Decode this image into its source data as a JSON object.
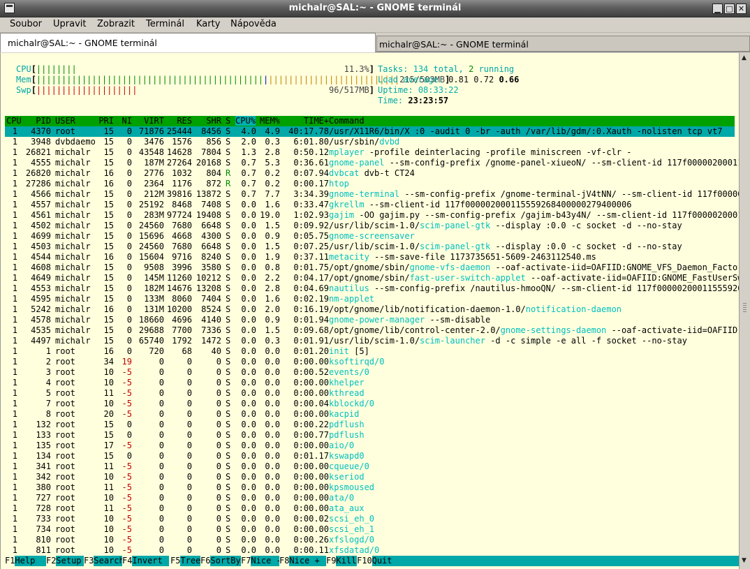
{
  "window": {
    "title": "michalr@SAL:~ - GNOME terminál",
    "menu": [
      "Soubor",
      "Upravit",
      "Zobrazit",
      "Terminál",
      "Karty",
      "Nápověda"
    ],
    "tabs": [
      {
        "label": "michalr@SAL:~ - GNOME terminál",
        "active": true
      },
      {
        "label": "michalr@SAL:~ - GNOME terminál",
        "active": false
      }
    ]
  },
  "meters": {
    "cpu": {
      "label": "CPU",
      "bars": "||||||||",
      "value": "11.3%"
    },
    "mem": {
      "label": "Mem",
      "bars_used": "|||||||||||||||||||||||||||||||||||||||||||||",
      "bars_buffer": "|",
      "bars_cache": "||||||||||||||||||||||||||",
      "value": "215/503MB"
    },
    "swp": {
      "label": "Swp",
      "bars": "||||||||||||||||||||",
      "value": "96/517MB"
    }
  },
  "info": {
    "tasks_label": "Tasks:",
    "tasks_total": "134",
    "total_label": "total,",
    "tasks_running": "2",
    "running_label": "running",
    "load_label": "Load average:",
    "load1": "0.81",
    "load5": "0.72",
    "load15": "0.66",
    "uptime_label": "Uptime:",
    "uptime": "08:33:22",
    "time_label": "Time:",
    "time": "23:23:57"
  },
  "columns": [
    "CPU",
    "PID",
    "USER",
    "PRI",
    "NI",
    "VIRT",
    "RES",
    "SHR",
    "S",
    "CPU%",
    "MEM%",
    "TIME+",
    "Command"
  ],
  "processes": [
    {
      "cpu": "1",
      "pid": "4370",
      "user": "root",
      "pri": "15",
      "ni": "0",
      "virt": "71876",
      "res": "25444",
      "shr": "8456",
      "s": "S",
      "cpup": "4.0",
      "memp": "4.9",
      "time": "40:17.78",
      "cmd_pre": "/usr/X11R6/bin/X :0 -audit 0 -br -auth /var/lib/gdm/:0.Xauth -nolisten tcp vt7",
      "cmd_hl": "",
      "cmd_post": ""
    },
    {
      "cpu": "1",
      "pid": "3948",
      "user": "dvbdaemo",
      "pri": "15",
      "ni": "0",
      "virt": "3476",
      "res": "1576",
      "shr": "856",
      "s": "S",
      "cpup": "2.0",
      "memp": "0.3",
      "time": "6:01.80",
      "cmd_pre": "/usr/sbin/",
      "cmd_hl": "dvbd",
      "cmd_post": ""
    },
    {
      "cpu": "1",
      "pid": "26821",
      "user": "michalr",
      "pri": "15",
      "ni": "0",
      "virt": "43548",
      "res": "14628",
      "shr": "7804",
      "s": "S",
      "cpup": "1.3",
      "memp": "2.8",
      "time": "0:50.12",
      "cmd_pre": "",
      "cmd_hl": "mplayer",
      "cmd_post": " -profile deinterlacing -profile miniscreen -vf-clr -"
    },
    {
      "cpu": "1",
      "pid": "4555",
      "user": "michalr",
      "pri": "15",
      "ni": "0",
      "virt": "187M",
      "res": "27264",
      "shr": "20168",
      "s": "S",
      "cpup": "0.7",
      "memp": "5.3",
      "time": "0:36.61",
      "cmd_pre": "",
      "cmd_hl": "gnome-panel",
      "cmd_post": " --sm-config-prefix /gnome-panel-xiueoN/ --sm-client-id 117f000002000115"
    },
    {
      "cpu": "1",
      "pid": "26820",
      "user": "michalr",
      "pri": "16",
      "ni": "0",
      "virt": "2776",
      "res": "1032",
      "shr": "804",
      "s": "R",
      "cpup": "0.7",
      "memp": "0.2",
      "time": "0:07.94",
      "cmd_pre": "",
      "cmd_hl": "dvbcat",
      "cmd_post": " dvb-t CT24"
    },
    {
      "cpu": "1",
      "pid": "27286",
      "user": "michalr",
      "pri": "16",
      "ni": "0",
      "virt": "2364",
      "res": "1176",
      "shr": "872",
      "s": "R",
      "cpup": "0.7",
      "memp": "0.2",
      "time": "0:00.17",
      "cmd_pre": "",
      "cmd_hl": "htop",
      "cmd_post": ""
    },
    {
      "cpu": "1",
      "pid": "4566",
      "user": "michalr",
      "pri": "15",
      "ni": "0",
      "virt": "212M",
      "res": "39816",
      "shr": "13872",
      "s": "S",
      "cpup": "0.7",
      "memp": "7.7",
      "time": "3:34.39",
      "cmd_pre": "",
      "cmd_hl": "gnome-terminal",
      "cmd_post": " --sm-config-prefix /gnome-terminal-jV4tNN/ --sm-client-id 117f000002"
    },
    {
      "cpu": "1",
      "pid": "4557",
      "user": "michalr",
      "pri": "15",
      "ni": "0",
      "virt": "25192",
      "res": "8468",
      "shr": "7408",
      "s": "S",
      "cpup": "0.0",
      "memp": "1.6",
      "time": "0:33.47",
      "cmd_pre": "",
      "cmd_hl": "gkrellm",
      "cmd_post": " --sm-client-id 117f000002000115559268400000279400006"
    },
    {
      "cpu": "1",
      "pid": "4561",
      "user": "michalr",
      "pri": "15",
      "ni": "0",
      "virt": "283M",
      "res": "97724",
      "shr": "19408",
      "s": "S",
      "cpup": "0.0",
      "memp": "19.0",
      "time": "1:02.93",
      "cmd_pre": "",
      "cmd_hl": "gajim",
      "cmd_post": " -OO gajim.py --sm-config-prefix /gajim-b43y4N/ --sm-client-id 117f00000200011"
    },
    {
      "cpu": "1",
      "pid": "4502",
      "user": "michalr",
      "pri": "15",
      "ni": "0",
      "virt": "24560",
      "res": "7680",
      "shr": "6648",
      "s": "S",
      "cpup": "0.0",
      "memp": "1.5",
      "time": "0:09.92",
      "cmd_pre": "/usr/lib/scim-1.0/",
      "cmd_hl": "scim-panel-gtk",
      "cmd_post": " --display :0.0 -c socket -d --no-stay"
    },
    {
      "cpu": "1",
      "pid": "4699",
      "user": "michalr",
      "pri": "15",
      "ni": "0",
      "virt": "15696",
      "res": "4668",
      "shr": "4300",
      "s": "S",
      "cpup": "0.0",
      "memp": "0.9",
      "time": "0:05.75",
      "cmd_pre": "",
      "cmd_hl": "gnome-screensaver",
      "cmd_post": ""
    },
    {
      "cpu": "1",
      "pid": "4503",
      "user": "michalr",
      "pri": "15",
      "ni": "0",
      "virt": "24560",
      "res": "7680",
      "shr": "6648",
      "s": "S",
      "cpup": "0.0",
      "memp": "1.5",
      "time": "0:07.25",
      "cmd_pre": "/usr/lib/scim-1.0/",
      "cmd_hl": "scim-panel-gtk",
      "cmd_post": " --display :0.0 -c socket -d --no-stay"
    },
    {
      "cpu": "1",
      "pid": "4544",
      "user": "michalr",
      "pri": "16",
      "ni": "0",
      "virt": "15604",
      "res": "9716",
      "shr": "8240",
      "s": "S",
      "cpup": "0.0",
      "memp": "1.9",
      "time": "0:37.11",
      "cmd_pre": "",
      "cmd_hl": "metacity",
      "cmd_post": " --sm-save-file 1173735651-5609-2463112540.ms"
    },
    {
      "cpu": "1",
      "pid": "4608",
      "user": "michalr",
      "pri": "15",
      "ni": "0",
      "virt": "9508",
      "res": "3996",
      "shr": "3580",
      "s": "S",
      "cpup": "0.0",
      "memp": "0.8",
      "time": "0:01.75",
      "cmd_pre": "/opt/gnome/sbin/",
      "cmd_hl": "gnome-vfs-daemon",
      "cmd_post": " --oaf-activate-iid=OAFIID:GNOME_VFS_Daemon_Factory"
    },
    {
      "cpu": "1",
      "pid": "4649",
      "user": "michalr",
      "pri": "15",
      "ni": "0",
      "virt": "145M",
      "res": "11260",
      "shr": "10212",
      "s": "S",
      "cpup": "0.0",
      "memp": "2.2",
      "time": "0:04.17",
      "cmd_pre": "/opt/gnome/sbin/",
      "cmd_hl": "fast-user-switch-applet",
      "cmd_post": " --oaf-activate-iid=OAFIID:GNOME_FastUserSwi"
    },
    {
      "cpu": "1",
      "pid": "4553",
      "user": "michalr",
      "pri": "15",
      "ni": "0",
      "virt": "182M",
      "res": "14676",
      "shr": "13208",
      "s": "S",
      "cpup": "0.0",
      "memp": "2.8",
      "time": "0:04.69",
      "cmd_pre": "",
      "cmd_hl": "nautilus",
      "cmd_post": " --sm-config-prefix /nautilus-hmooQN/ --sm-client-id 117f000002000115559267"
    },
    {
      "cpu": "1",
      "pid": "4595",
      "user": "michalr",
      "pri": "15",
      "ni": "0",
      "virt": "133M",
      "res": "8060",
      "shr": "7404",
      "s": "S",
      "cpup": "0.0",
      "memp": "1.6",
      "time": "0:02.19",
      "cmd_pre": "",
      "cmd_hl": "nm-applet",
      "cmd_post": ""
    },
    {
      "cpu": "1",
      "pid": "5242",
      "user": "michalr",
      "pri": "16",
      "ni": "0",
      "virt": "131M",
      "res": "10200",
      "shr": "8524",
      "s": "S",
      "cpup": "0.0",
      "memp": "2.0",
      "time": "0:16.19",
      "cmd_pre": "/opt/gnome/lib/notification-daemon-1.0/",
      "cmd_hl": "notification-daemon",
      "cmd_post": ""
    },
    {
      "cpu": "1",
      "pid": "4578",
      "user": "michalr",
      "pri": "15",
      "ni": "0",
      "virt": "18660",
      "res": "4696",
      "shr": "4140",
      "s": "S",
      "cpup": "0.0",
      "memp": "0.9",
      "time": "0:01.94",
      "cmd_pre": "",
      "cmd_hl": "gnome-power-manager",
      "cmd_post": " --sm-disable"
    },
    {
      "cpu": "1",
      "pid": "4535",
      "user": "michalr",
      "pri": "15",
      "ni": "0",
      "virt": "29688",
      "res": "7700",
      "shr": "7336",
      "s": "S",
      "cpup": "0.0",
      "memp": "1.5",
      "time": "0:09.68",
      "cmd_pre": "/opt/gnome/lib/control-center-2.0/",
      "cmd_hl": "gnome-settings-daemon",
      "cmd_post": " --oaf-activate-iid=OAFIID:G"
    },
    {
      "cpu": "1",
      "pid": "4497",
      "user": "michalr",
      "pri": "15",
      "ni": "0",
      "virt": "65740",
      "res": "1792",
      "shr": "1472",
      "s": "S",
      "cpup": "0.0",
      "memp": "0.3",
      "time": "0:01.91",
      "cmd_pre": "/usr/lib/scim-1.0/",
      "cmd_hl": "scim-launcher",
      "cmd_post": " -d -c simple -e all -f socket --no-stay"
    },
    {
      "cpu": "1",
      "pid": "1",
      "user": "root",
      "pri": "16",
      "ni": "0",
      "virt": "720",
      "res": "68",
      "shr": "40",
      "s": "S",
      "cpup": "0.0",
      "memp": "0.0",
      "time": "0:01.20",
      "cmd_pre": "",
      "cmd_hl": "init",
      "cmd_post": " [5]"
    },
    {
      "cpu": "1",
      "pid": "2",
      "user": "root",
      "pri": "34",
      "ni": "19",
      "virt": "0",
      "res": "0",
      "shr": "0",
      "s": "S",
      "cpup": "0.0",
      "memp": "0.0",
      "time": "0:00.00",
      "cmd_pre": "",
      "cmd_hl": "ksoftirqd/0",
      "cmd_post": ""
    },
    {
      "cpu": "1",
      "pid": "3",
      "user": "root",
      "pri": "10",
      "ni": "-5",
      "virt": "0",
      "res": "0",
      "shr": "0",
      "s": "S",
      "cpup": "0.0",
      "memp": "0.0",
      "time": "0:00.52",
      "cmd_pre": "",
      "cmd_hl": "events/0",
      "cmd_post": ""
    },
    {
      "cpu": "1",
      "pid": "4",
      "user": "root",
      "pri": "10",
      "ni": "-5",
      "virt": "0",
      "res": "0",
      "shr": "0",
      "s": "S",
      "cpup": "0.0",
      "memp": "0.0",
      "time": "0:00.00",
      "cmd_pre": "",
      "cmd_hl": "khelper",
      "cmd_post": ""
    },
    {
      "cpu": "1",
      "pid": "5",
      "user": "root",
      "pri": "11",
      "ni": "-5",
      "virt": "0",
      "res": "0",
      "shr": "0",
      "s": "S",
      "cpup": "0.0",
      "memp": "0.0",
      "time": "0:00.00",
      "cmd_pre": "",
      "cmd_hl": "kthread",
      "cmd_post": ""
    },
    {
      "cpu": "1",
      "pid": "7",
      "user": "root",
      "pri": "10",
      "ni": "-5",
      "virt": "0",
      "res": "0",
      "shr": "0",
      "s": "S",
      "cpup": "0.0",
      "memp": "0.0",
      "time": "0:00.04",
      "cmd_pre": "",
      "cmd_hl": "kblockd/0",
      "cmd_post": ""
    },
    {
      "cpu": "1",
      "pid": "8",
      "user": "root",
      "pri": "20",
      "ni": "-5",
      "virt": "0",
      "res": "0",
      "shr": "0",
      "s": "S",
      "cpup": "0.0",
      "memp": "0.0",
      "time": "0:00.00",
      "cmd_pre": "",
      "cmd_hl": "kacpid",
      "cmd_post": ""
    },
    {
      "cpu": "1",
      "pid": "132",
      "user": "root",
      "pri": "15",
      "ni": "0",
      "virt": "0",
      "res": "0",
      "shr": "0",
      "s": "S",
      "cpup": "0.0",
      "memp": "0.0",
      "time": "0:00.22",
      "cmd_pre": "",
      "cmd_hl": "pdflush",
      "cmd_post": ""
    },
    {
      "cpu": "1",
      "pid": "133",
      "user": "root",
      "pri": "15",
      "ni": "0",
      "virt": "0",
      "res": "0",
      "shr": "0",
      "s": "S",
      "cpup": "0.0",
      "memp": "0.0",
      "time": "0:00.77",
      "cmd_pre": "",
      "cmd_hl": "pdflush",
      "cmd_post": ""
    },
    {
      "cpu": "1",
      "pid": "135",
      "user": "root",
      "pri": "17",
      "ni": "-5",
      "virt": "0",
      "res": "0",
      "shr": "0",
      "s": "S",
      "cpup": "0.0",
      "memp": "0.0",
      "time": "0:00.00",
      "cmd_pre": "",
      "cmd_hl": "aio/0",
      "cmd_post": ""
    },
    {
      "cpu": "1",
      "pid": "134",
      "user": "root",
      "pri": "15",
      "ni": "0",
      "virt": "0",
      "res": "0",
      "shr": "0",
      "s": "S",
      "cpup": "0.0",
      "memp": "0.0",
      "time": "0:01.17",
      "cmd_pre": "",
      "cmd_hl": "kswapd0",
      "cmd_post": ""
    },
    {
      "cpu": "1",
      "pid": "341",
      "user": "root",
      "pri": "11",
      "ni": "-5",
      "virt": "0",
      "res": "0",
      "shr": "0",
      "s": "S",
      "cpup": "0.0",
      "memp": "0.0",
      "time": "0:00.00",
      "cmd_pre": "",
      "cmd_hl": "cqueue/0",
      "cmd_post": ""
    },
    {
      "cpu": "1",
      "pid": "342",
      "user": "root",
      "pri": "10",
      "ni": "-5",
      "virt": "0",
      "res": "0",
      "shr": "0",
      "s": "S",
      "cpup": "0.0",
      "memp": "0.0",
      "time": "0:00.00",
      "cmd_pre": "",
      "cmd_hl": "kseriod",
      "cmd_post": ""
    },
    {
      "cpu": "1",
      "pid": "380",
      "user": "root",
      "pri": "11",
      "ni": "-5",
      "virt": "0",
      "res": "0",
      "shr": "0",
      "s": "S",
      "cpup": "0.0",
      "memp": "0.0",
      "time": "0:00.00",
      "cmd_pre": "",
      "cmd_hl": "kpsmoused",
      "cmd_post": ""
    },
    {
      "cpu": "1",
      "pid": "727",
      "user": "root",
      "pri": "10",
      "ni": "-5",
      "virt": "0",
      "res": "0",
      "shr": "0",
      "s": "S",
      "cpup": "0.0",
      "memp": "0.0",
      "time": "0:00.00",
      "cmd_pre": "",
      "cmd_hl": "ata/0",
      "cmd_post": ""
    },
    {
      "cpu": "1",
      "pid": "728",
      "user": "root",
      "pri": "11",
      "ni": "-5",
      "virt": "0",
      "res": "0",
      "shr": "0",
      "s": "S",
      "cpup": "0.0",
      "memp": "0.0",
      "time": "0:00.00",
      "cmd_pre": "",
      "cmd_hl": "ata_aux",
      "cmd_post": ""
    },
    {
      "cpu": "1",
      "pid": "733",
      "user": "root",
      "pri": "10",
      "ni": "-5",
      "virt": "0",
      "res": "0",
      "shr": "0",
      "s": "S",
      "cpup": "0.0",
      "memp": "0.0",
      "time": "0:00.02",
      "cmd_pre": "",
      "cmd_hl": "scsi_eh_0",
      "cmd_post": ""
    },
    {
      "cpu": "1",
      "pid": "734",
      "user": "root",
      "pri": "10",
      "ni": "-5",
      "virt": "0",
      "res": "0",
      "shr": "0",
      "s": "S",
      "cpup": "0.0",
      "memp": "0.0",
      "time": "0:00.00",
      "cmd_pre": "",
      "cmd_hl": "scsi_eh_1",
      "cmd_post": ""
    },
    {
      "cpu": "1",
      "pid": "810",
      "user": "root",
      "pri": "10",
      "ni": "-5",
      "virt": "0",
      "res": "0",
      "shr": "0",
      "s": "S",
      "cpup": "0.0",
      "memp": "0.0",
      "time": "0:00.26",
      "cmd_pre": "",
      "cmd_hl": "xfslogd/0",
      "cmd_post": ""
    },
    {
      "cpu": "1",
      "pid": "811",
      "user": "root",
      "pri": "10",
      "ni": "-5",
      "virt": "0",
      "res": "0",
      "shr": "0",
      "s": "S",
      "cpup": "0.0",
      "memp": "0.0",
      "time": "0:00.11",
      "cmd_pre": "",
      "cmd_hl": "xfsdatad/0",
      "cmd_post": ""
    }
  ],
  "function_keys": [
    {
      "key": "F1",
      "label": "Help"
    },
    {
      "key": "F2",
      "label": "Setup"
    },
    {
      "key": "F3",
      "label": "Search"
    },
    {
      "key": "F4",
      "label": "Invert"
    },
    {
      "key": "F5",
      "label": "Tree"
    },
    {
      "key": "F6",
      "label": "SortBy"
    },
    {
      "key": "F7",
      "label": "Nice -"
    },
    {
      "key": "F8",
      "label": "Nice +"
    },
    {
      "key": "F9",
      "label": "Kill"
    },
    {
      "key": "F10",
      "label": "Quit"
    }
  ],
  "colors": {
    "terminal_bg": "#ffffdd",
    "header_bg": "#00a000",
    "selection_bg": "#00a8a8",
    "highlight_cmd": "#00c0c0"
  }
}
